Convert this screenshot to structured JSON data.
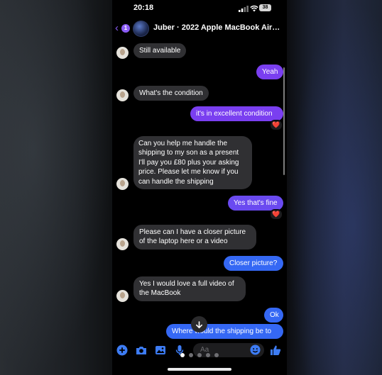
{
  "status_bar": {
    "time": "20:18",
    "battery": "38"
  },
  "header": {
    "back_badge": "1",
    "title": "Juber · 2022 Apple MacBook Air…"
  },
  "messages": [
    {
      "id": "m1",
      "direction": "incoming",
      "text": "Still available"
    },
    {
      "id": "m2",
      "direction": "outgoing",
      "text": "Yeah"
    },
    {
      "id": "m3",
      "direction": "incoming",
      "text": "What's the condition"
    },
    {
      "id": "m4",
      "direction": "outgoing",
      "text": "it's in excellent condition",
      "reaction": "❤️"
    },
    {
      "id": "m5",
      "direction": "incoming",
      "text": "Can you help me handle the shipping to my son as a present I'll pay you £80 plus your asking price. Please let me know if you can handle the shipping"
    },
    {
      "id": "m6",
      "direction": "outgoing",
      "text": "Yes that's fine",
      "reaction": "❤️"
    },
    {
      "id": "m7",
      "direction": "incoming",
      "text": "Please can I have a closer picture of the laptop here or a video"
    },
    {
      "id": "m8",
      "direction": "outgoing",
      "text": "Closer picture?"
    },
    {
      "id": "m9",
      "direction": "incoming",
      "text": "Yes I would love a full video of the MacBook"
    },
    {
      "id": "m10",
      "direction": "outgoing",
      "text": "Ok"
    },
    {
      "id": "m11",
      "direction": "outgoing",
      "text": "Where would the shipping be to"
    }
  ],
  "composer": {
    "placeholder": "Aa"
  },
  "colors": {
    "accent_purple": "#7a3ff0",
    "accent_blue": "#3568f4",
    "incoming_bubble": "#303033",
    "icon_blue": "#3d7cf4"
  },
  "icons": [
    "signal-icon",
    "wifi-icon",
    "battery-icon",
    "back-chevron-icon",
    "plus-icon",
    "camera-icon",
    "photo-icon",
    "microphone-icon",
    "emoji-icon",
    "thumbs-up-icon",
    "arrow-down-icon"
  ]
}
